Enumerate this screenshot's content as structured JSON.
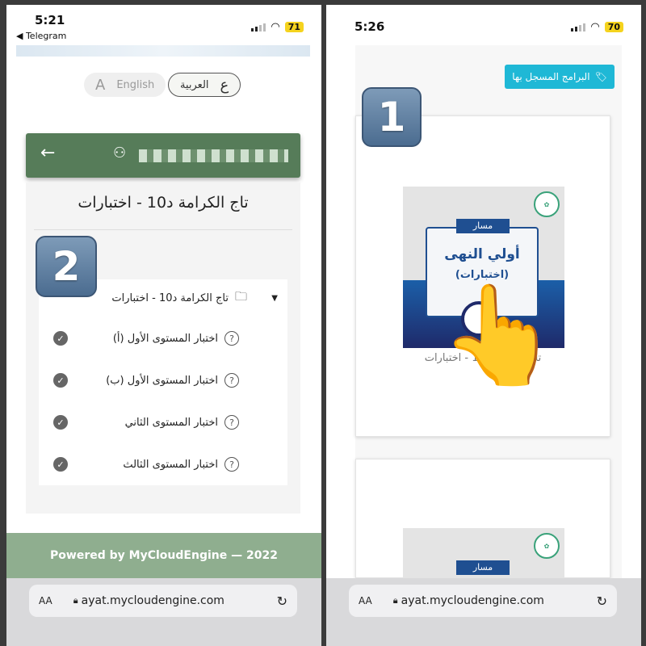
{
  "left": {
    "status": {
      "time": "5:21",
      "back_app": "◀ Telegram",
      "battery": "71"
    },
    "language": {
      "english_icon": "A",
      "english": "English",
      "arabic_icon": "ع",
      "arabic": "العربية",
      "selected": "العربية"
    },
    "header": {
      "back_icon": "←",
      "user_icon": "person-off-icon"
    },
    "page_title": "تاج الكرامة د10 - اختبارات",
    "step_badge": "2",
    "folder": {
      "label": "تاج الكرامة د10 - اختبارات",
      "icon": "folder-icon"
    },
    "items": [
      {
        "label": "اختبار المستوى الأول (أ)"
      },
      {
        "label": "اختبار المستوى الأول (ب)"
      },
      {
        "label": "اختبار المستوى الثاني"
      },
      {
        "label": "اختبار المستوى الثالث"
      }
    ],
    "footer": "Powered by MyCloudEngine — 2022",
    "address": {
      "aa": "AA",
      "url": "ayat.mycloudengine.com"
    }
  },
  "right": {
    "status": {
      "time": "5:26",
      "battery": "70"
    },
    "programs_button": "البرامج المسجل بها",
    "step_badge": "1",
    "course": {
      "ribbon": "مسار",
      "title": "أولي النهى",
      "subtitle": "(اختبارات)",
      "caption": "تاج الكرامة د10 - اختبارات"
    },
    "course2": {
      "ribbon": "مسار"
    },
    "address": {
      "aa": "AA",
      "url": "ayat.mycloudengine.com"
    }
  },
  "colors": {
    "header_green": "#567c59",
    "footer_green": "#8fae8f",
    "accent_cyan": "#1fb8d6",
    "course_blue": "#1f4f91"
  }
}
